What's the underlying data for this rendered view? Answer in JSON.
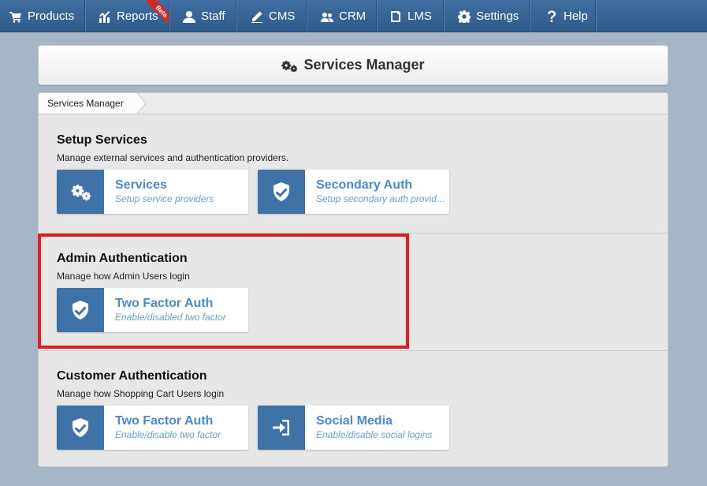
{
  "nav": {
    "items": [
      {
        "label": "Products",
        "icon": "cart-icon"
      },
      {
        "label": "Reports",
        "icon": "chart-icon",
        "badge": "Beta"
      },
      {
        "label": "Staff",
        "icon": "user-icon"
      },
      {
        "label": "CMS",
        "icon": "pencil-icon"
      },
      {
        "label": "CRM",
        "icon": "users-icon"
      },
      {
        "label": "LMS",
        "icon": "book-icon"
      },
      {
        "label": "Settings",
        "icon": "gear-icon"
      },
      {
        "label": "Help",
        "icon": "question-icon"
      }
    ]
  },
  "header": {
    "title": "Services Manager",
    "icon": "gears-icon"
  },
  "breadcrumb": {
    "current": "Services Manager"
  },
  "sections": [
    {
      "title": "Setup Services",
      "description": "Manage external services and authentication providers.",
      "tiles": [
        {
          "title": "Services",
          "subtitle": "Setup service providers",
          "icon": "gears-icon"
        },
        {
          "title": "Secondary Auth",
          "subtitle": "Setup secondary auth providers",
          "icon": "shield-check-icon"
        }
      ]
    },
    {
      "title": "Admin Authentication",
      "description": "Manage how Admin Users login",
      "tiles": [
        {
          "title": "Two Factor Auth",
          "subtitle": "Enable/disabled two factor",
          "icon": "shield-check-icon"
        }
      ]
    },
    {
      "title": "Customer Authentication",
      "description": "Manage how Shopping Cart Users login",
      "tiles": [
        {
          "title": "Two Factor Auth",
          "subtitle": "Enable/disable two factor",
          "icon": "shield-check-icon"
        },
        {
          "title": "Social Media",
          "subtitle": "Enable/disable social logins",
          "icon": "sign-in-icon"
        }
      ]
    }
  ],
  "colors": {
    "nav": "#3a6a9b",
    "tile_icon_bg": "#3f73a7",
    "tile_title": "#4b8ad0",
    "highlight": "#e01e26",
    "beta_ribbon": "#d52a2a"
  }
}
